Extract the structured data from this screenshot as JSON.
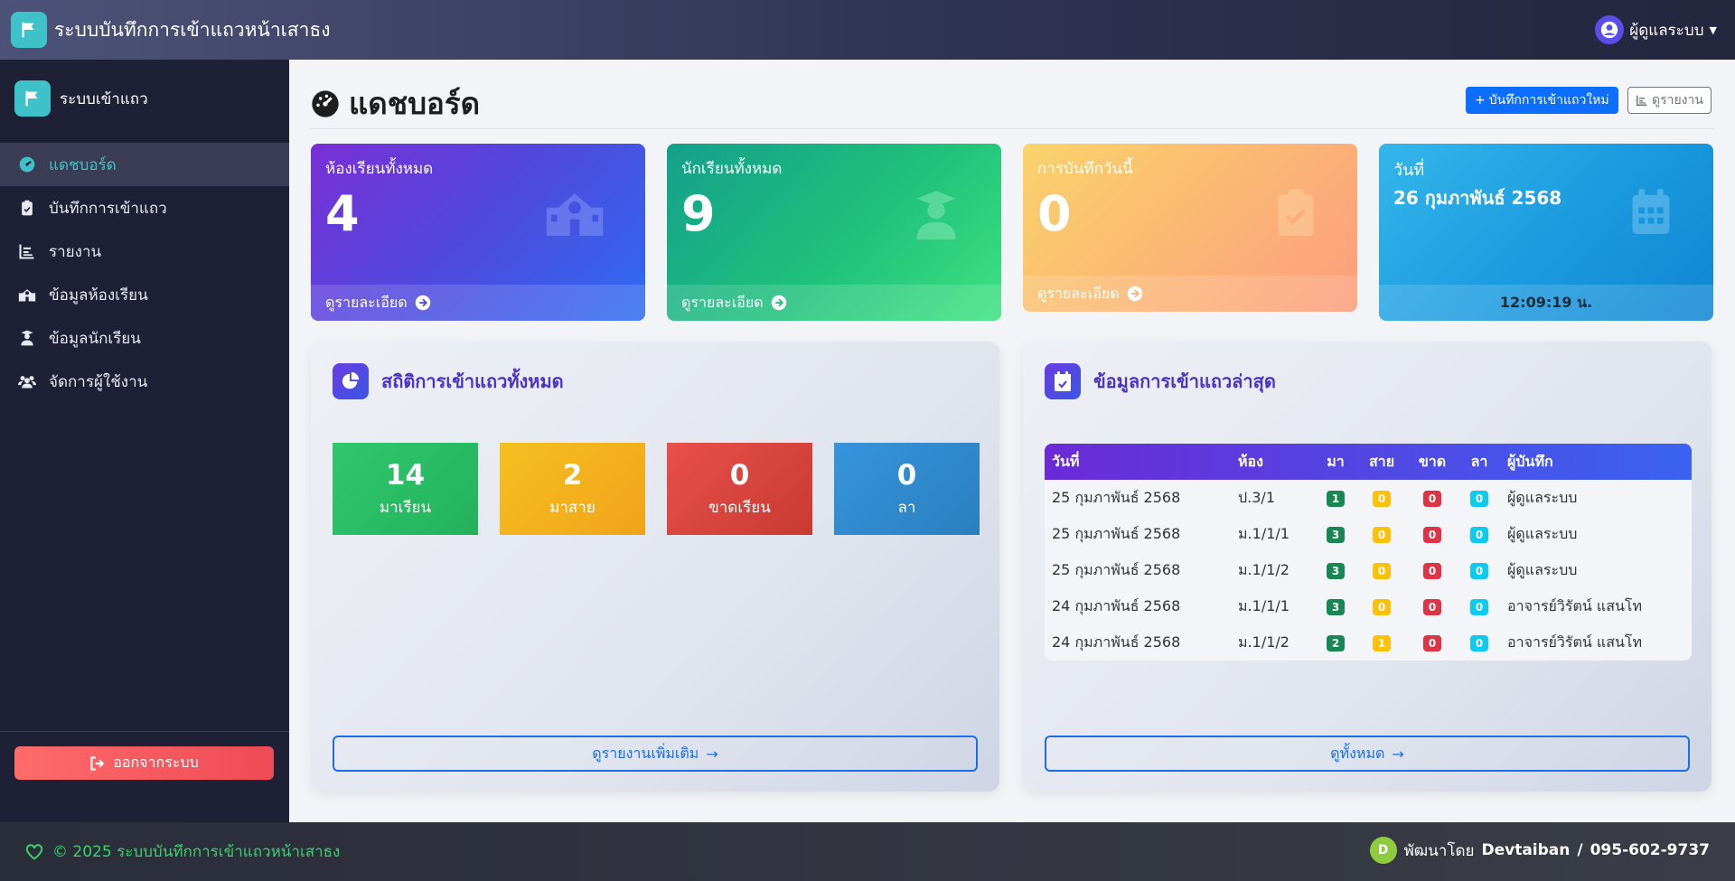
{
  "app": {
    "title": "ระบบบันทึกการเข้าแถวหน้าเสาธง"
  },
  "user": {
    "name": "ผู้ดูแลระบบ"
  },
  "sidebar": {
    "brand": "ระบบเข้าแถว",
    "items": [
      {
        "label": "แดชบอร์ด",
        "icon": "dashboard-icon"
      },
      {
        "label": "บันทึกการเข้าแถว",
        "icon": "clipboard-icon"
      },
      {
        "label": "รายงาน",
        "icon": "chart-icon"
      },
      {
        "label": "ข้อมูลห้องเรียน",
        "icon": "school-icon"
      },
      {
        "label": "ข้อมูลนักเรียน",
        "icon": "teacher-icon"
      },
      {
        "label": "จัดการผู้ใช้งาน",
        "icon": "users-icon"
      }
    ],
    "logout": "ออกจากระบบ"
  },
  "header": {
    "title": "แดชบอร์ด",
    "new_button": "บันทึกการเข้าแถวใหม่",
    "report_button": "ดูรายงาน"
  },
  "cards": [
    {
      "label": "ห้องเรียนทั้งหมด",
      "value": "4",
      "footer": "ดูรายละเอียด"
    },
    {
      "label": "นักเรียนทั้งหมด",
      "value": "9",
      "footer": "ดูรายละเอียด"
    },
    {
      "label": "การบันทึกวันนี้",
      "value": "0",
      "footer": "ดูรายละเอียด"
    },
    {
      "label": "วันที่",
      "value": "26 กุมภาพันธ์ 2568",
      "footer": "12:09:19 น."
    }
  ],
  "stats_panel": {
    "title": "สถิติการเข้าแถวทั้งหมด",
    "items": [
      {
        "value": "14",
        "label": "มาเรียน"
      },
      {
        "value": "2",
        "label": "มาสาย"
      },
      {
        "value": "0",
        "label": "ขาดเรียน"
      },
      {
        "value": "0",
        "label": "ลา"
      }
    ],
    "more_button": "ดูรายงานเพิ่มเติม"
  },
  "recent_panel": {
    "title": "ข้อมูลการเข้าแถวล่าสุด",
    "columns": [
      "วันที่",
      "ห้อง",
      "มา",
      "สาย",
      "ขาด",
      "ลา",
      "ผู้บันทึก"
    ],
    "rows": [
      {
        "date": "25 กุมภาพันธ์ 2568",
        "room": "ป.3/1",
        "present": "1",
        "late": "0",
        "absent": "0",
        "leave": "0",
        "recorder": "ผู้ดูแลระบบ"
      },
      {
        "date": "25 กุมภาพันธ์ 2568",
        "room": "ม.1/1/1",
        "present": "3",
        "late": "0",
        "absent": "0",
        "leave": "0",
        "recorder": "ผู้ดูแลระบบ"
      },
      {
        "date": "25 กุมภาพันธ์ 2568",
        "room": "ม.1/1/2",
        "present": "3",
        "late": "0",
        "absent": "0",
        "leave": "0",
        "recorder": "ผู้ดูแลระบบ"
      },
      {
        "date": "24 กุมภาพันธ์ 2568",
        "room": "ม.1/1/1",
        "present": "3",
        "late": "0",
        "absent": "0",
        "leave": "0",
        "recorder": "อาจารย์วิรัตน์ แสนโท"
      },
      {
        "date": "24 กุมภาพันธ์ 2568",
        "room": "ม.1/1/2",
        "present": "2",
        "late": "1",
        "absent": "0",
        "leave": "0",
        "recorder": "อาจารย์วิรัตน์ แสนโท"
      }
    ],
    "all_button": "ดูทั้งหมด"
  },
  "footer": {
    "copyright": "© 2025 ระบบบันทึกการเข้าแถวหน้าเสาธง",
    "developed_by": "พัฒนาโดย",
    "developer": "Devtaiban",
    "separator": "/",
    "phone": "095-602-9737"
  },
  "colors": {
    "accent": "#3fc1c9",
    "primary": "#0d6efd",
    "sidebar": "#1e2035"
  }
}
